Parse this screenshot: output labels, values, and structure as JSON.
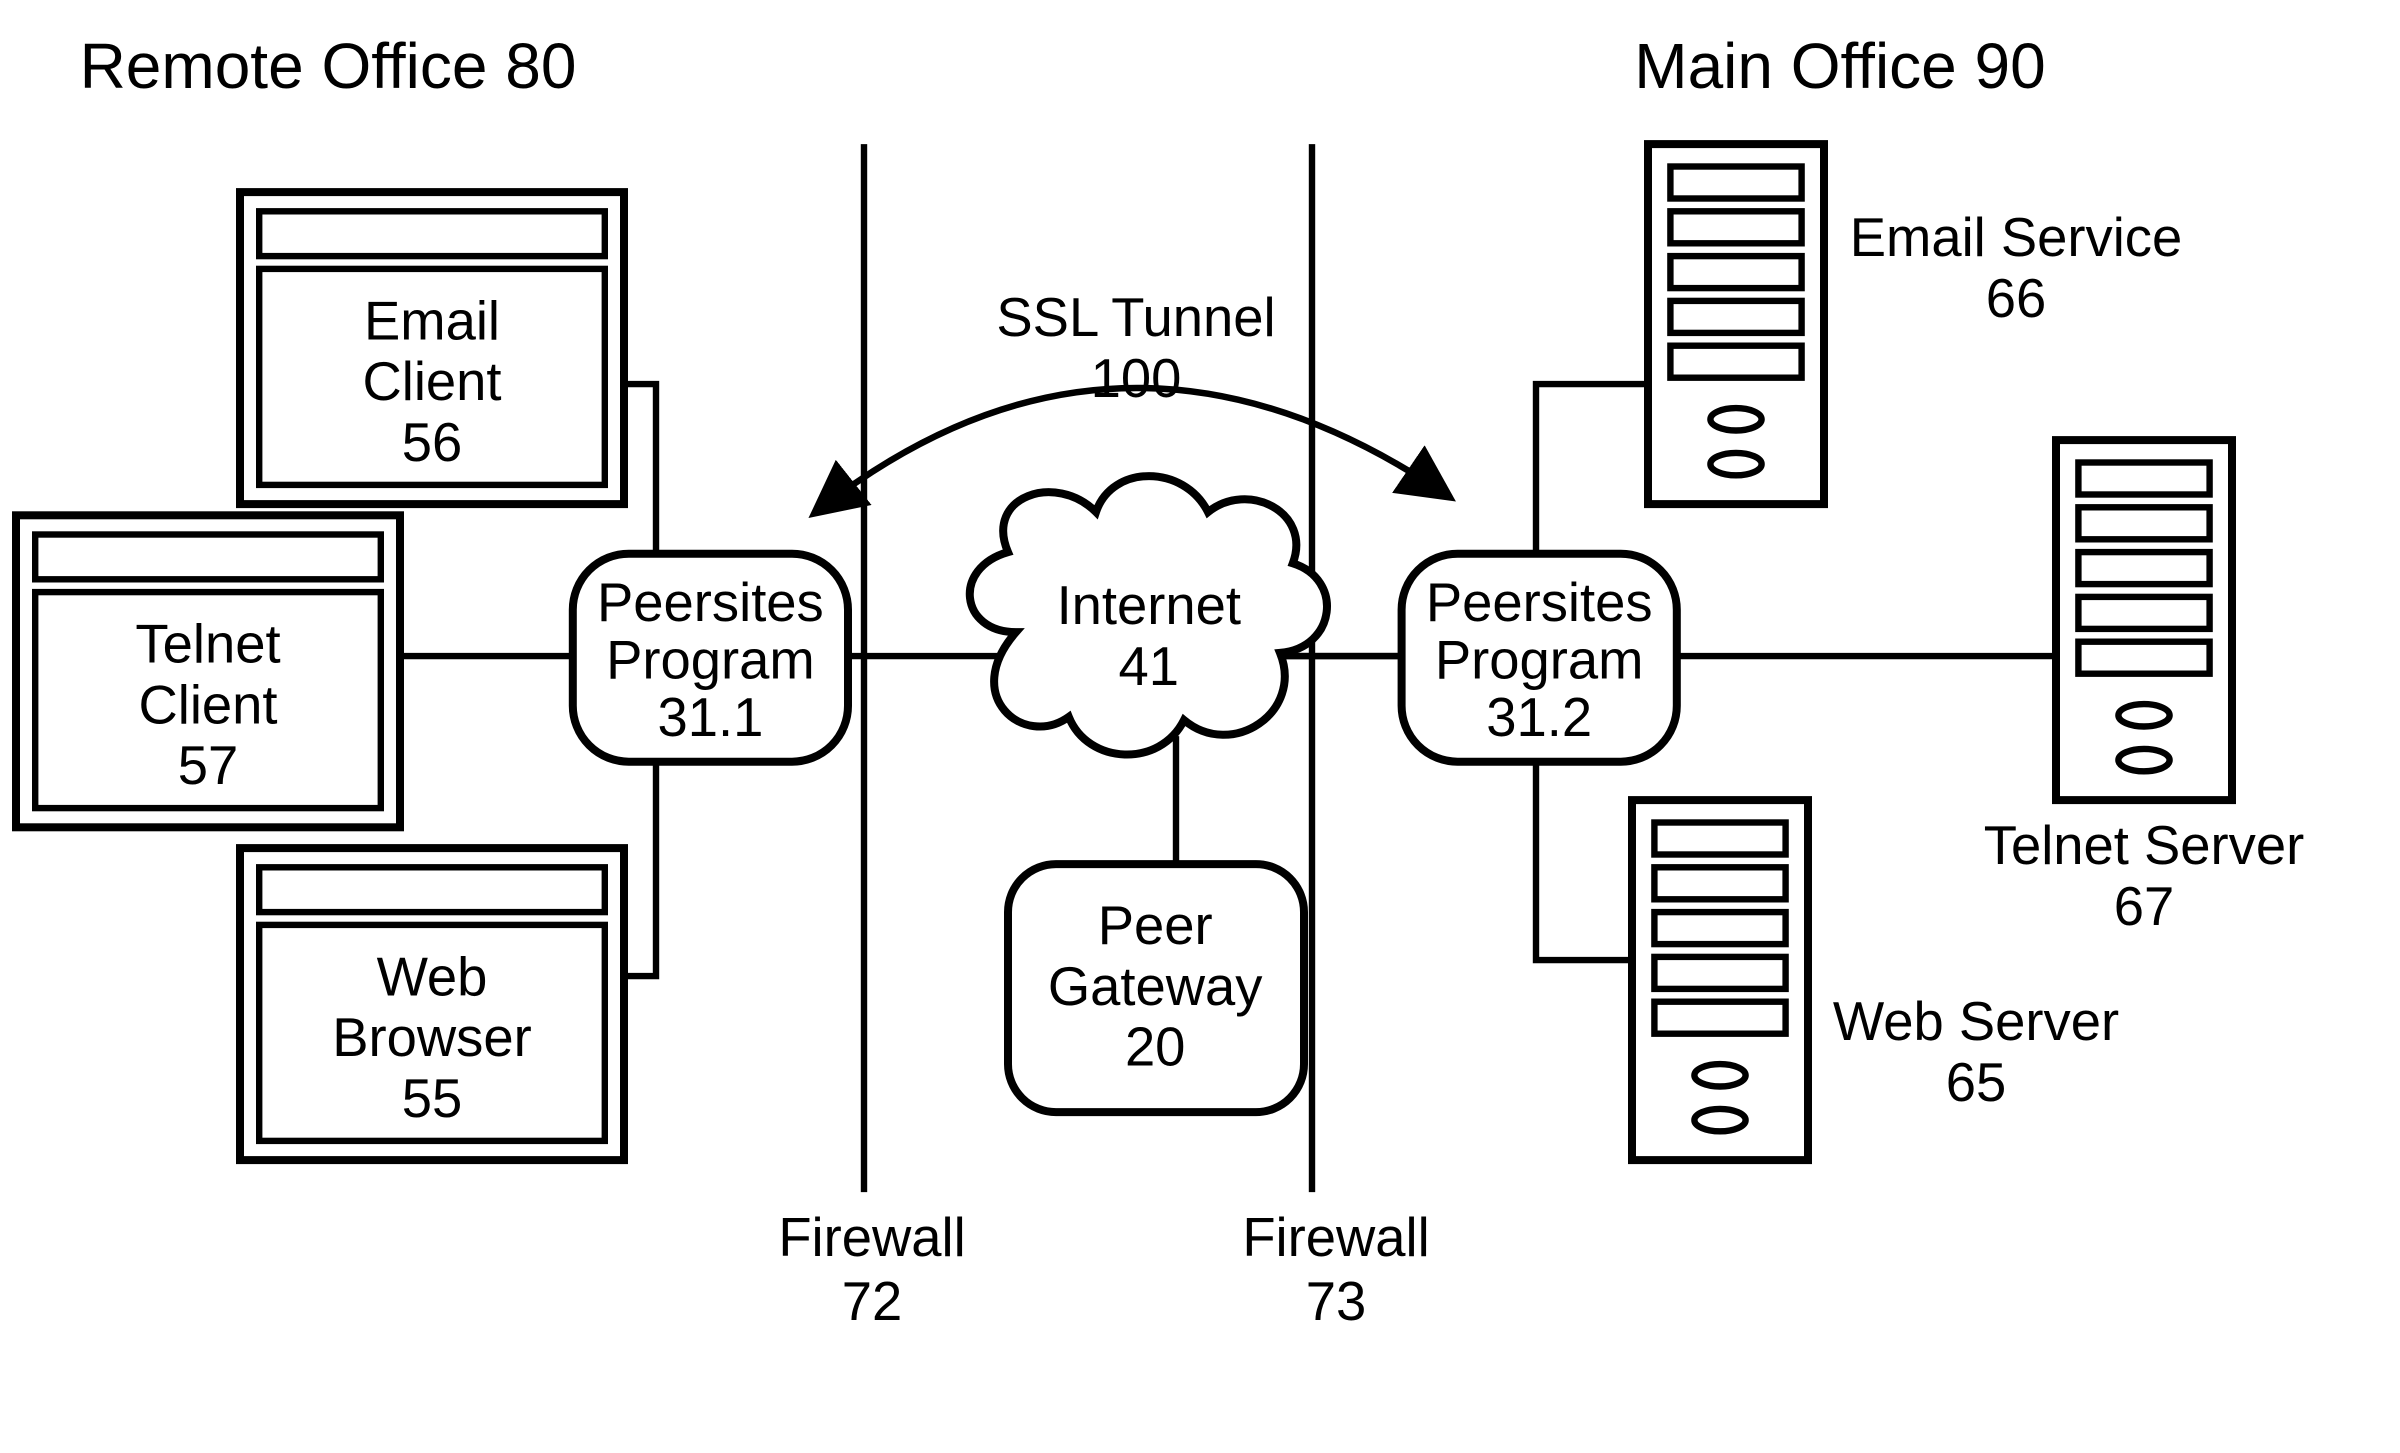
{
  "titles": {
    "remote": {
      "name": "Remote Office",
      "num": "80"
    },
    "main": {
      "name": "Main Office",
      "num": "90"
    }
  },
  "clients": {
    "email": {
      "l1": "Email",
      "l2": "Client",
      "num": "56"
    },
    "telnet": {
      "l1": "Telnet",
      "l2": "Client",
      "num": "57"
    },
    "web": {
      "l1": "Web",
      "l2": "Browser",
      "num": "55"
    }
  },
  "servers": {
    "email": {
      "name": "Email Service",
      "num": "66"
    },
    "telnet": {
      "name": "Telnet Server",
      "num": "67"
    },
    "web": {
      "name": "Web Server",
      "num": "65"
    }
  },
  "programs": {
    "left": {
      "l1": "Peersites",
      "l2": "Program",
      "num": "31.1"
    },
    "right": {
      "l1": "Peersites",
      "l2": "Program",
      "num": "31.2"
    }
  },
  "internet": {
    "name": "Internet",
    "num": "41"
  },
  "gateway": {
    "l1": "Peer",
    "l2": "Gateway",
    "num": "20"
  },
  "tunnel": {
    "name": "SSL Tunnel",
    "num": "100"
  },
  "firewalls": {
    "left": {
      "name": "Firewall",
      "num": "72"
    },
    "right": {
      "name": "Firewall",
      "num": "73"
    }
  }
}
